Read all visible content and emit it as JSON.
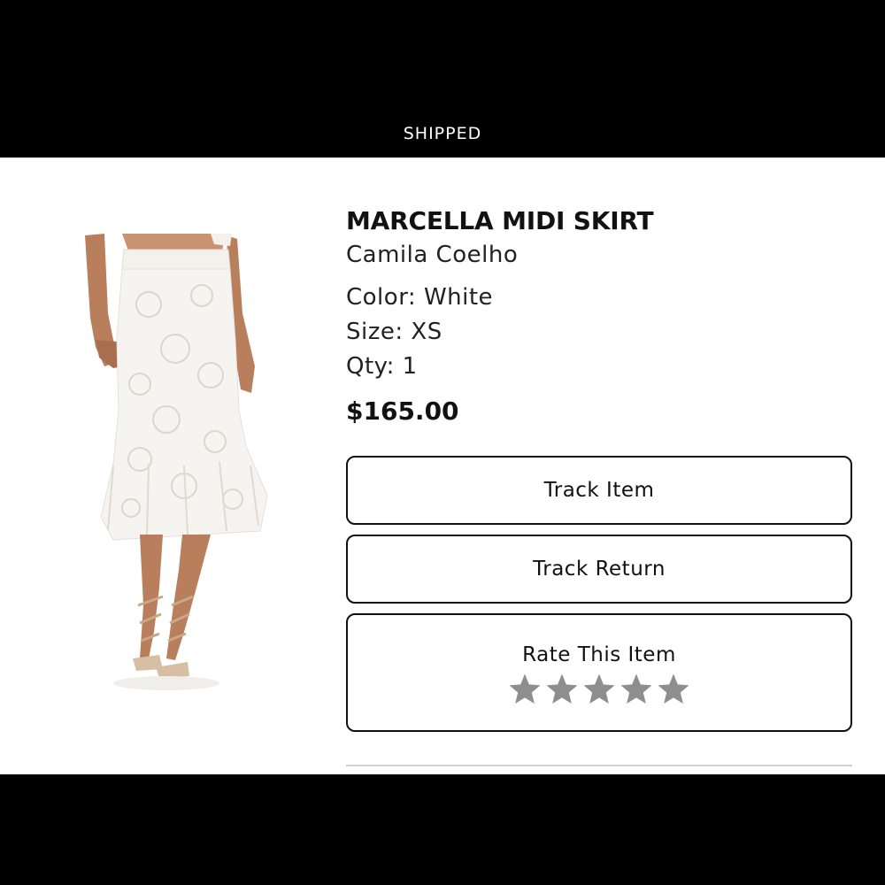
{
  "order_status": {
    "label": "SHIPPED"
  },
  "product": {
    "name": "MARCELLA MIDI SKIRT",
    "brand": "Camila Coelho",
    "color": "Color: White",
    "size": "Size: XS",
    "qty": "Qty: 1",
    "price": "$165.00",
    "image_icon": "white-midi-skirt-photo"
  },
  "actions": {
    "track_item_label": "Track Item",
    "track_return_label": "Track Return",
    "rate_label": "Rate This Item",
    "rating": {
      "max_stars": 5,
      "selected": 0,
      "star_color": "#8e8e8e",
      "icon": "star-icon"
    }
  },
  "colors": {
    "frame_bg": "#000000",
    "content_bg": "#ffffff",
    "text": "#111111",
    "divider": "#cfcfcf"
  }
}
